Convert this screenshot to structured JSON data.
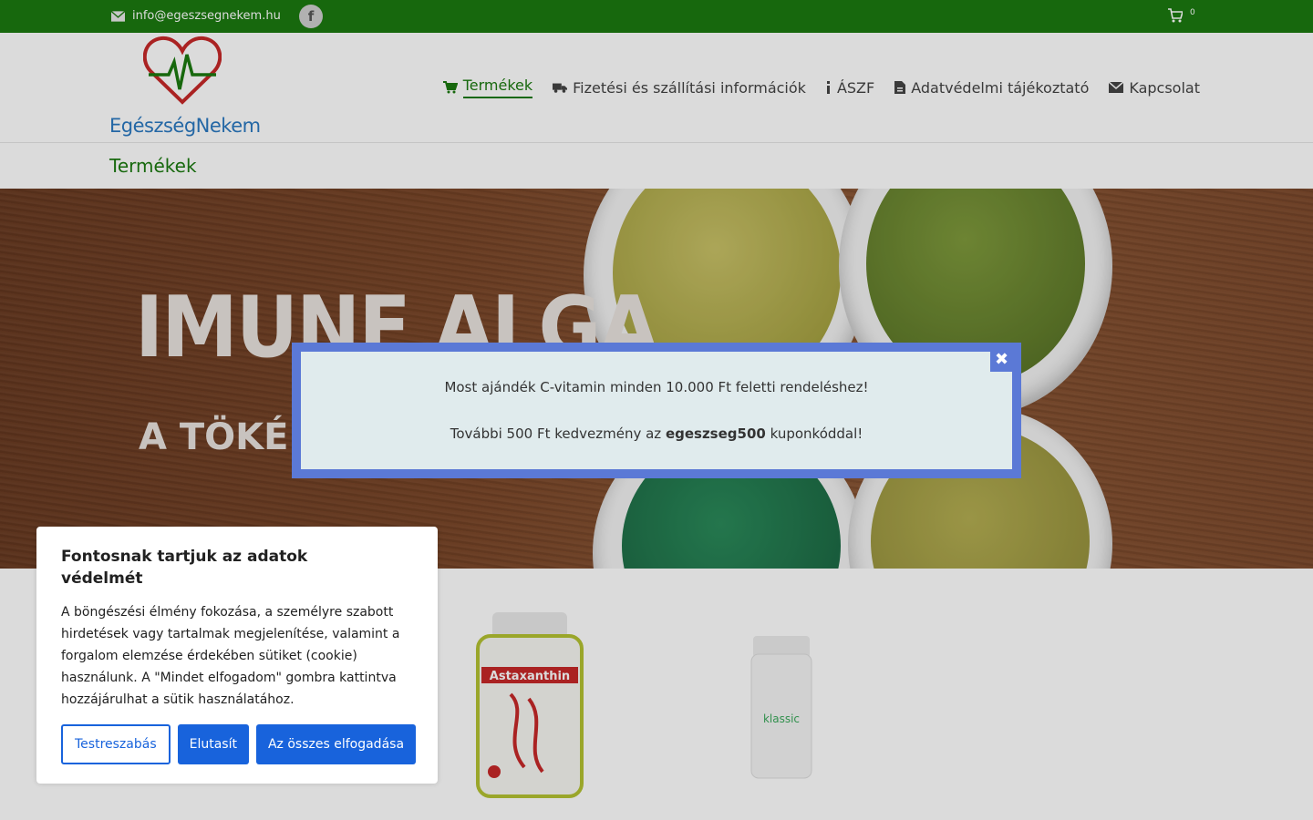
{
  "topbar": {
    "email": "info@egeszsegnekem.hu",
    "facebook_icon": "facebook-icon",
    "cart_count": "0"
  },
  "header": {
    "brand": "EgészségNekem",
    "nav": [
      {
        "label": "Termékek",
        "icon": "cart-icon",
        "active": true
      },
      {
        "label": "Fizetési és szállítási információk",
        "icon": "truck-icon",
        "active": false
      },
      {
        "label": "ÁSZF",
        "icon": "info-icon",
        "active": false
      },
      {
        "label": "Adatvédelmi tájékoztató",
        "icon": "document-icon",
        "active": false
      },
      {
        "label": "Kapcsolat",
        "icon": "envelope-icon",
        "active": false
      }
    ]
  },
  "breadcrumb": {
    "title": "Termékek"
  },
  "hero": {
    "headline": "IMUNE ALGA",
    "subline": "A TÖKÉLET"
  },
  "popup": {
    "line1": "Most  ajándék C-vitamin minden 10.000 Ft feletti rendeléshez!",
    "line2_pre": "További 500 Ft kedvezmény az ",
    "line2_code": "egeszseg500",
    "line2_post": " kuponkóddal!",
    "close_icon": "close-icon"
  },
  "cookie": {
    "title": "Fontosnak tartjuk az adatok védelmét",
    "text": "A böngészési élmény fokozása, a személyre szabott hirdetések vagy tartalmak megjelenítése, valamint a forgalom elemzése érdekében sütiket (cookie) használunk. A \"Mindet elfogadom\" gombra kattintva hozzájárulhat a sütik használatához.",
    "customize_label": "Testreszabás",
    "reject_label": "Elutasít",
    "accept_label": "Az összes elfogadása"
  },
  "products": [
    {
      "label": "Astaxanthin"
    },
    {
      "label": "klassic"
    }
  ],
  "colors": {
    "brand_green": "#1b7a10",
    "brand_blue": "#2a79c0",
    "popup_border": "#5b79d6",
    "cookie_button": "#1863dc"
  }
}
